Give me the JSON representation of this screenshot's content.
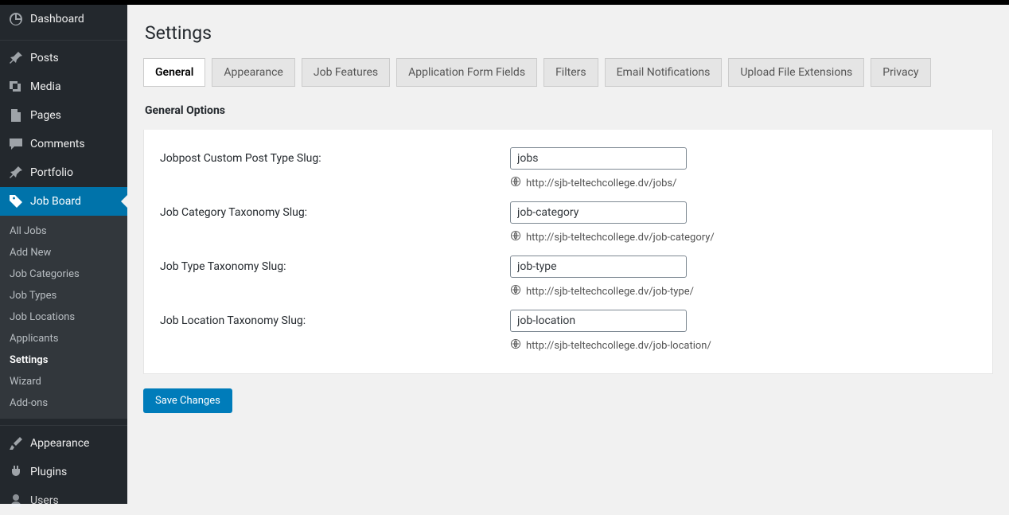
{
  "sidebar": {
    "items": [
      {
        "label": "Dashboard"
      },
      {
        "label": "Posts"
      },
      {
        "label": "Media"
      },
      {
        "label": "Pages"
      },
      {
        "label": "Comments"
      },
      {
        "label": "Portfolio"
      },
      {
        "label": "Job Board"
      },
      {
        "label": "Appearance"
      },
      {
        "label": "Plugins"
      },
      {
        "label": "Users"
      }
    ],
    "submenu": [
      {
        "label": "All Jobs"
      },
      {
        "label": "Add New"
      },
      {
        "label": "Job Categories"
      },
      {
        "label": "Job Types"
      },
      {
        "label": "Job Locations"
      },
      {
        "label": "Applicants"
      },
      {
        "label": "Settings"
      },
      {
        "label": "Wizard"
      },
      {
        "label": "Add-ons"
      }
    ]
  },
  "page": {
    "title": "Settings",
    "section_heading": "General Options",
    "save_label": "Save Changes"
  },
  "tabs": [
    {
      "label": "General"
    },
    {
      "label": "Appearance"
    },
    {
      "label": "Job Features"
    },
    {
      "label": "Application Form Fields"
    },
    {
      "label": "Filters"
    },
    {
      "label": "Email Notifications"
    },
    {
      "label": "Upload File Extensions"
    },
    {
      "label": "Privacy"
    }
  ],
  "fields": [
    {
      "label": "Jobpost Custom Post Type Slug:",
      "value": "jobs",
      "hint": "http://sjb-teltechcollege.dv/jobs/"
    },
    {
      "label": "Job Category Taxonomy Slug:",
      "value": "job-category",
      "hint": "http://sjb-teltechcollege.dv/job-category/"
    },
    {
      "label": "Job Type Taxonomy Slug:",
      "value": "job-type",
      "hint": "http://sjb-teltechcollege.dv/job-type/"
    },
    {
      "label": "Job Location Taxonomy Slug:",
      "value": "job-location",
      "hint": "http://sjb-teltechcollege.dv/job-location/"
    }
  ]
}
